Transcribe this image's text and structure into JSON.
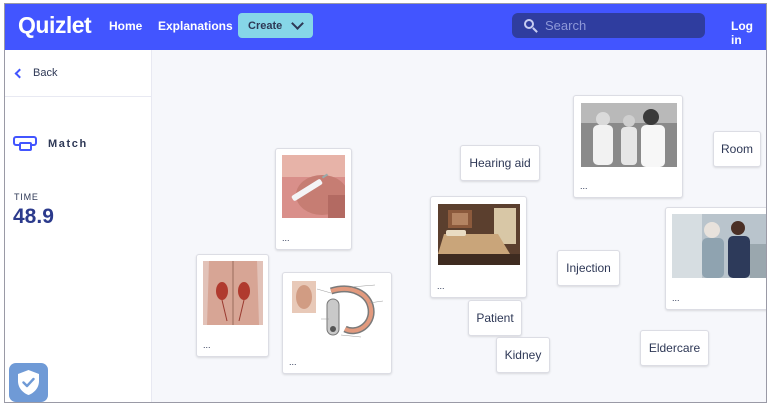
{
  "header": {
    "logo": "Quizlet",
    "nav": {
      "home": "Home",
      "explanations": "Explanations"
    },
    "create_label": "Create",
    "search_placeholder": "Search",
    "login": "Log in"
  },
  "sidebar": {
    "back_label": "Back",
    "mode_label": "Match",
    "time_label": "TIME",
    "time_value": "48.9"
  },
  "cards": {
    "terms": {
      "hearing_aid": "Hearing aid",
      "room": "Room",
      "injection": "Injection",
      "patient": "Patient",
      "kidney": "Kidney",
      "eldercare": "Eldercare"
    },
    "image_more": "..."
  },
  "colors": {
    "brand": "#4255ff",
    "create": "#86d6e8",
    "text": "#2e3856"
  }
}
